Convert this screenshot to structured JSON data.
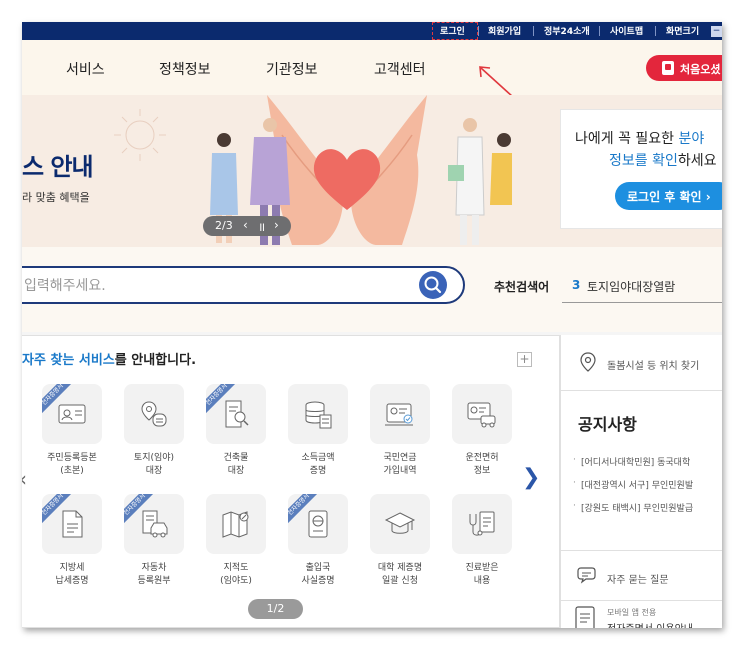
{
  "utility": {
    "items": [
      "로그인",
      "회원가입",
      "정부24소개",
      "사이트맵",
      "화면크기"
    ],
    "zoom_symbol": "−"
  },
  "nav": {
    "items": [
      "서비스",
      "정책정보",
      "기관정보",
      "고객센터"
    ],
    "cta_label": "처음오셨"
  },
  "banner": {
    "title": "스 안내",
    "subtitle": "라 맞춤 혜택을",
    "pager_text": "2/3",
    "card_line1_a": "나에게 꼭 필요한 ",
    "card_line1_b": "분야",
    "card_line2_a": "정보를 확인",
    "card_line2_b": "하세요",
    "card_button": "로그인 후 확인 ›"
  },
  "search": {
    "placeholder": "입력해주세요.",
    "recommend_label": "추천검색어",
    "recommend_index": "3",
    "recommend_term": "토지임야대장열람"
  },
  "services": {
    "heading_highlight": "자주 찾는 서비스",
    "heading_rest": "를 안내합니다.",
    "plus": "+",
    "ribbon_text": "전자증명서",
    "row1": [
      {
        "label1": "주민등록등본",
        "label2": "(초본)",
        "icon": "id-card-icon",
        "ribbon": true
      },
      {
        "label1": "토지(임야)",
        "label2": "대장",
        "icon": "map-pin-document-icon",
        "ribbon": false
      },
      {
        "label1": "건축물",
        "label2": "대장",
        "icon": "document-search-icon",
        "ribbon": true
      },
      {
        "label1": "소득금액",
        "label2": "증명",
        "icon": "coins-icon",
        "ribbon": false
      },
      {
        "label1": "국민연금",
        "label2": "가입내역",
        "icon": "pension-card-icon",
        "ribbon": false
      },
      {
        "label1": "운전면허",
        "label2": "정보",
        "icon": "driver-license-icon",
        "ribbon": false
      }
    ],
    "row2": [
      {
        "label1": "지방세",
        "label2": "납세증명",
        "icon": "tax-document-icon",
        "ribbon": true
      },
      {
        "label1": "자동차",
        "label2": "등록원부",
        "icon": "car-document-icon",
        "ribbon": true
      },
      {
        "label1": "지적도",
        "label2": "(임야도)",
        "icon": "folded-map-icon",
        "ribbon": false
      },
      {
        "label1": "출입국",
        "label2": "사실증명",
        "icon": "passport-icon",
        "ribbon": true
      },
      {
        "label1": "대학 제증명",
        "label2": "일괄 신청",
        "icon": "graduation-cap-icon",
        "ribbon": false
      },
      {
        "label1": "진료받은",
        "label2": "내용",
        "icon": "medical-record-icon",
        "ribbon": false
      }
    ],
    "page_text": "1/2"
  },
  "right": {
    "location_text": "돌봄시설 등 위치 찾기",
    "notice_title": "공지사항",
    "notices": [
      "[어디서나대학민원] 동국대학",
      "[대전광역시 서구] 무인민원발",
      "[강원도 태백시] 무인민원발급"
    ],
    "faq_text": "자주 묻는 질문",
    "mobile_small": "모바일 앱 전용",
    "mobile_main": "전자증명서 이용안내"
  },
  "colors": {
    "utility_bar": "#0b2a6e",
    "accent_blue": "#1a79c9",
    "cta_red": "#e3263c",
    "banner_bg": "#f7ece3"
  }
}
